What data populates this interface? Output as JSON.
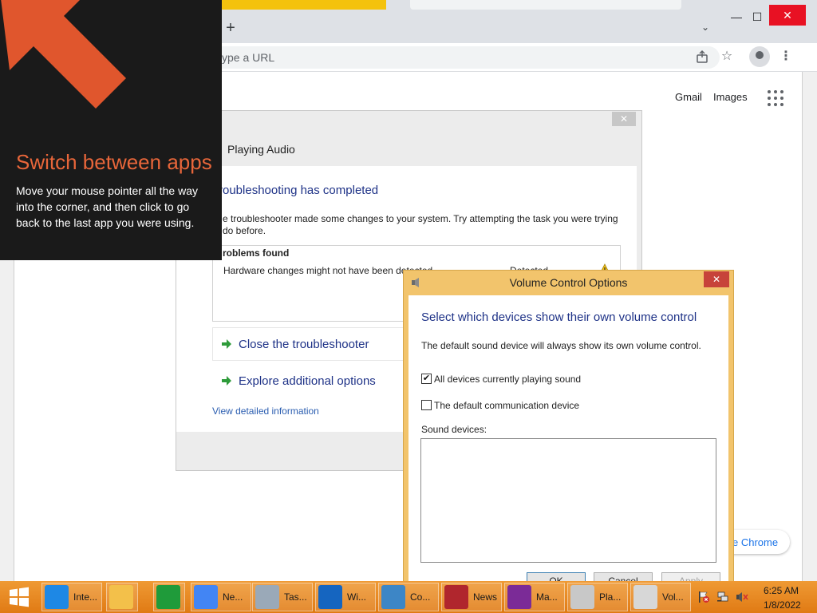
{
  "browser": {
    "omnibox_placeholder": "ype a URL",
    "links": {
      "gmail": "Gmail",
      "images": "Images"
    },
    "customize_chrome": "e Chrome",
    "new_tab_symbol": "+",
    "window_controls": {
      "minimize": "—",
      "maximize": "☐",
      "close": "✕"
    }
  },
  "tip": {
    "title": "Switch between apps",
    "body": "Move your mouse pointer all the way into the corner, and then click to go back to the last app you were using.",
    "accent_color": "#e8663a"
  },
  "troubleshooter": {
    "header_title": "Playing Audio",
    "heading": "roubleshooting has completed",
    "description": "e troubleshooter made some changes to your system. Try attempting the task you were trying do before.",
    "problems_title": "roblems found",
    "problems": [
      {
        "name": "Hardware changes might not have been detected",
        "status": "Detected",
        "icon": "warning-icon"
      }
    ],
    "actions": {
      "close": "Close the troubleshooter",
      "explore": "Explore additional options"
    },
    "view_details": "View detailed information",
    "close_glyph": "✕"
  },
  "volume_dialog": {
    "title": "Volume Control Options",
    "heading": "Select which devices show their own volume control",
    "description": "The default sound device will always show its own volume control.",
    "options": [
      {
        "label": "All devices currently playing sound",
        "checked": true
      },
      {
        "label": "The default communication device",
        "checked": false
      }
    ],
    "devices_label": "Sound devices:",
    "buttons": {
      "ok": "OK",
      "cancel": "Cancel",
      "apply": "Apply"
    },
    "close_glyph": "✕"
  },
  "taskbar": {
    "items": [
      {
        "label": "Inte...",
        "icon": "internet-explorer-icon",
        "color": "#1e88e5"
      },
      {
        "label": "",
        "icon": "file-explorer-icon",
        "color": "#f3c04a"
      },
      {
        "label": "",
        "icon": "store-icon",
        "color": "#1f9b3a"
      },
      {
        "label": "Ne...",
        "icon": "chrome-icon",
        "color": "#4285f4"
      },
      {
        "label": "Tas...",
        "icon": "task-manager-icon",
        "color": "#9aa9b8"
      },
      {
        "label": "Wi...",
        "icon": "help-icon",
        "color": "#1565c0"
      },
      {
        "label": "Co...",
        "icon": "control-panel-icon",
        "color": "#3d86c6"
      },
      {
        "label": "News",
        "icon": "news-icon",
        "color": "#b0262d"
      },
      {
        "label": "Ma...",
        "icon": "maps-icon",
        "color": "#7b2b97"
      },
      {
        "label": "Pla...",
        "icon": "audio-troubleshooter-icon",
        "color": "#c8c8c8"
      },
      {
        "label": "Vol...",
        "icon": "volume-icon",
        "color": "#d7d7d7"
      }
    ],
    "tray": {
      "time": "6:25 AM",
      "date": "1/8/2022"
    }
  }
}
